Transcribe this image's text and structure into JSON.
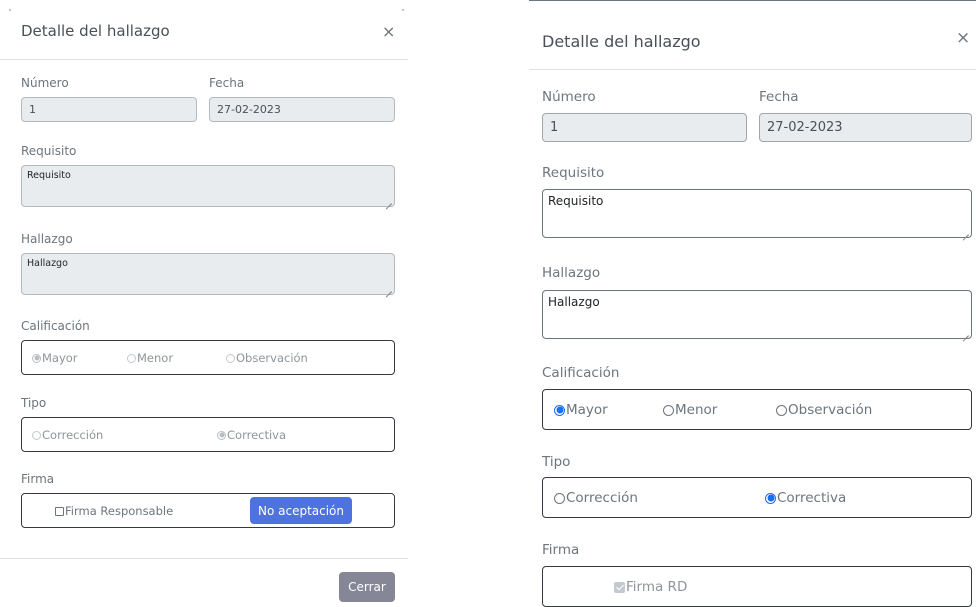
{
  "left_modal": {
    "title": "Detalle del hallazgo",
    "close_glyph": "×",
    "numero_label": "Número",
    "numero_value": "1",
    "fecha_label": "Fecha",
    "fecha_value": "27-02-2023",
    "requisito_label": "Requisito",
    "requisito_value": "Requisito",
    "hallazgo_label": "Hallazgo",
    "hallazgo_value": "Hallazgo",
    "calificacion_label": "Calificación",
    "calificacion_options": [
      {
        "label": "Mayor",
        "selected": true
      },
      {
        "label": "Menor",
        "selected": false
      },
      {
        "label": "Observación",
        "selected": false
      }
    ],
    "tipo_label": "Tipo",
    "tipo_options": [
      {
        "label": "Corrección",
        "selected": false
      },
      {
        "label": "Correctiva",
        "selected": true
      }
    ],
    "firma_label": "Firma",
    "firma_checkbox_label": "Firma Responsable",
    "firma_checked": false,
    "no_aceptacion_button": "No aceptación",
    "cerrar_button": "Cerrar"
  },
  "right_modal": {
    "title": "Detalle del hallazgo",
    "close_glyph": "×",
    "numero_label": "Número",
    "numero_value": "1",
    "fecha_label": "Fecha",
    "fecha_value": "27-02-2023",
    "requisito_label": "Requisito",
    "requisito_value": "Requisito",
    "hallazgo_label": "Hallazgo",
    "hallazgo_value": "Hallazgo",
    "calificacion_label": "Calificación",
    "calificacion_options": [
      {
        "label": "Mayor",
        "selected": true
      },
      {
        "label": "Menor",
        "selected": false
      },
      {
        "label": "Observación",
        "selected": false
      }
    ],
    "tipo_label": "Tipo",
    "tipo_options": [
      {
        "label": "Corrección",
        "selected": false
      },
      {
        "label": "Correctiva",
        "selected": true
      }
    ],
    "firma_label": "Firma",
    "firma_checkbox_label": "Firma RD",
    "firma_checked": true
  },
  "colors": {
    "primary": "#4e73df",
    "secondary": "#858796",
    "radio_selected": "#1a6ef5",
    "border_dark": "#343a40"
  }
}
